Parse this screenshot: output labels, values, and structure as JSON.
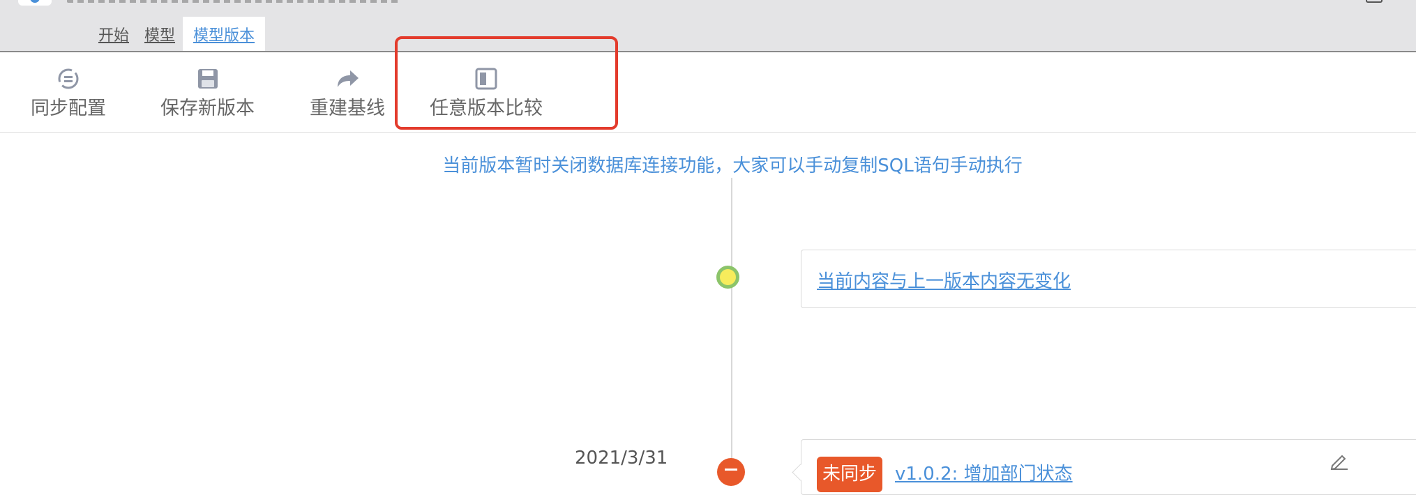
{
  "tabs": [
    {
      "label": "开始"
    },
    {
      "label": "模型"
    },
    {
      "label": "模型版本"
    }
  ],
  "toolbar": {
    "sync_label": "同步配置",
    "save_label": "保存新版本",
    "rebuild_label": "重建基线",
    "compare_label": "任意版本比较"
  },
  "notice": "当前版本暂时关闭数据库连接功能，大家可以手动复制SQL语句手动执行",
  "timeline": {
    "current_text": "当前内容与上一版本内容无变化",
    "entry": {
      "date": "2021/3/31",
      "badge": "未同步",
      "title": "v1.0.2: 增加部门状态"
    }
  },
  "colors": {
    "accent": "#4a90d9",
    "highlight_border": "#e33b2c",
    "badge": "#e8582a",
    "current_dot": "#f7ec5c",
    "current_dot_border": "#8cc46a"
  },
  "icons": [
    "sync-icon",
    "save-icon",
    "redo-icon",
    "compare-icon",
    "edit-icon"
  ]
}
